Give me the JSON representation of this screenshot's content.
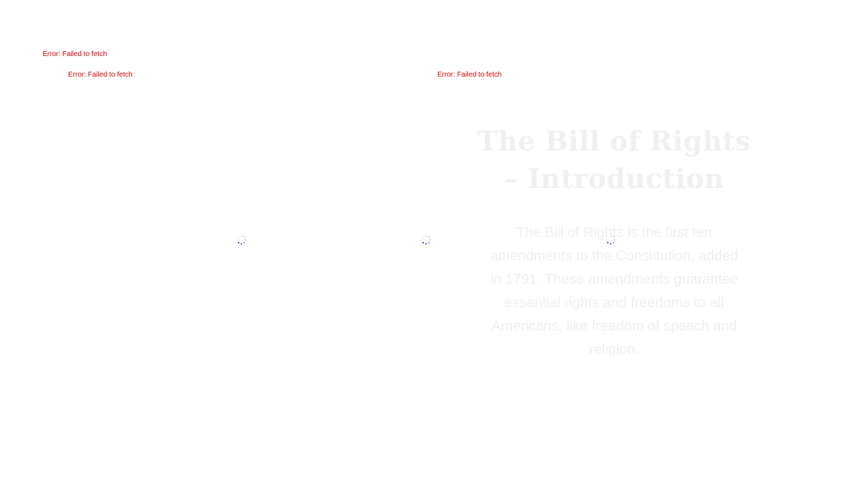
{
  "errors": [
    "Error: Failed to fetch",
    "Error: Failed to fetch",
    "Error: Failed to fetch"
  ],
  "slide": {
    "title": "The Bill of Rights – Introduction",
    "body": "The Bill of Rights is the first ten amendments to the Constitution, added in 1791. These amendments guarantee essential rights and freedoms to all Americans, like freedom of speech and religion."
  },
  "colors": {
    "error": "#d40000",
    "spinner": "#1a1a9a",
    "slide_text": "#efefef"
  },
  "icons": {
    "spinner": "loading-spinner-icon"
  }
}
